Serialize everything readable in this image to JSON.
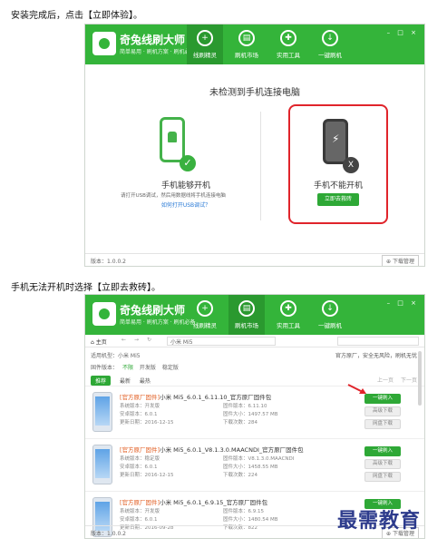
{
  "caption_top": "安装完成后，点击【立即体验】。",
  "caption_mid": "手机无法开机时选择【立即去救砖】。",
  "app": {
    "brand": "奇兔线刷大师",
    "slogan": "简单易用 · 刷机方案 · 刷机必备",
    "nav": [
      "线刷精灵",
      "刷机市场",
      "实用工具",
      "一键刷机"
    ],
    "version": "版本：1.0.0.2",
    "download_mgr": "下载管理",
    "win_controls": "– □ ×"
  },
  "shot1": {
    "title": "未检测到手机连接电脑",
    "left_title": "手机能够开机",
    "left_desc": "请打开USB调试，然后用数据线将手机连接电脑",
    "left_link": "如何打开USB调试？",
    "right_title": "手机不能开机",
    "right_button": "立即去救砖",
    "check_glyph": "✓",
    "x_glyph": "X"
  },
  "shot2": {
    "toolbar_home": "主页",
    "addr": "小米 Mi5",
    "model_label": "适用机型：",
    "model_value": "小米 Mi5",
    "filters_label": "固件版本：",
    "filters": [
      "不限",
      "开发版",
      "稳定版"
    ],
    "promises": "官方原厂，安全无风险，刷机无忧",
    "tabs": [
      "推荐",
      "最新",
      "最热"
    ],
    "pager": [
      "上一页",
      "下一页"
    ],
    "rows": [
      {
        "tag": "[官方原厂固件]",
        "name": "小米 Mi5_6.0.1_6.11.10_官方原厂固件包",
        "l1": "系统版本：开发版",
        "l2": "安卓版本：6.0.1",
        "l3": "更新日期：2016-12-15",
        "r1": "固件版本：6.11.10",
        "r2": "固件大小：1497.57 MB",
        "r3": "下载次数：284",
        "btn": "一键刷入",
        "g1": "高级下载",
        "g2": "网盘下载"
      },
      {
        "tag": "[官方原厂固件]",
        "name": "小米 Mi5_6.0.1_V8.1.3.0.MAACNDI_官方原厂固件包",
        "l1": "系统版本：稳定版",
        "l2": "安卓版本：6.0.1",
        "l3": "更新日期：2016-12-15",
        "r1": "固件版本：V8.1.3.0.MAACNDI",
        "r2": "固件大小：1458.55 MB",
        "r3": "下载次数：224",
        "btn": "一键刷入",
        "g1": "高级下载",
        "g2": "网盘下载"
      },
      {
        "tag": "[官方原厂固件]",
        "name": "小米 Mi5_6.0.1_6.9.15_官方原厂固件包",
        "l1": "系统版本：开发版",
        "l2": "安卓版本：6.0.1",
        "l3": "更新日期：2016-09-28",
        "r1": "固件版本：6.9.15",
        "r2": "固件大小：1480.54 MB",
        "r3": "下载次数：822",
        "btn": "一键刷入"
      }
    ]
  },
  "watermark": "最需教育",
  "colors": {
    "brand_green": "#34b43a",
    "highlight_red": "#e0242b",
    "tag_orange": "#e15a1d"
  }
}
